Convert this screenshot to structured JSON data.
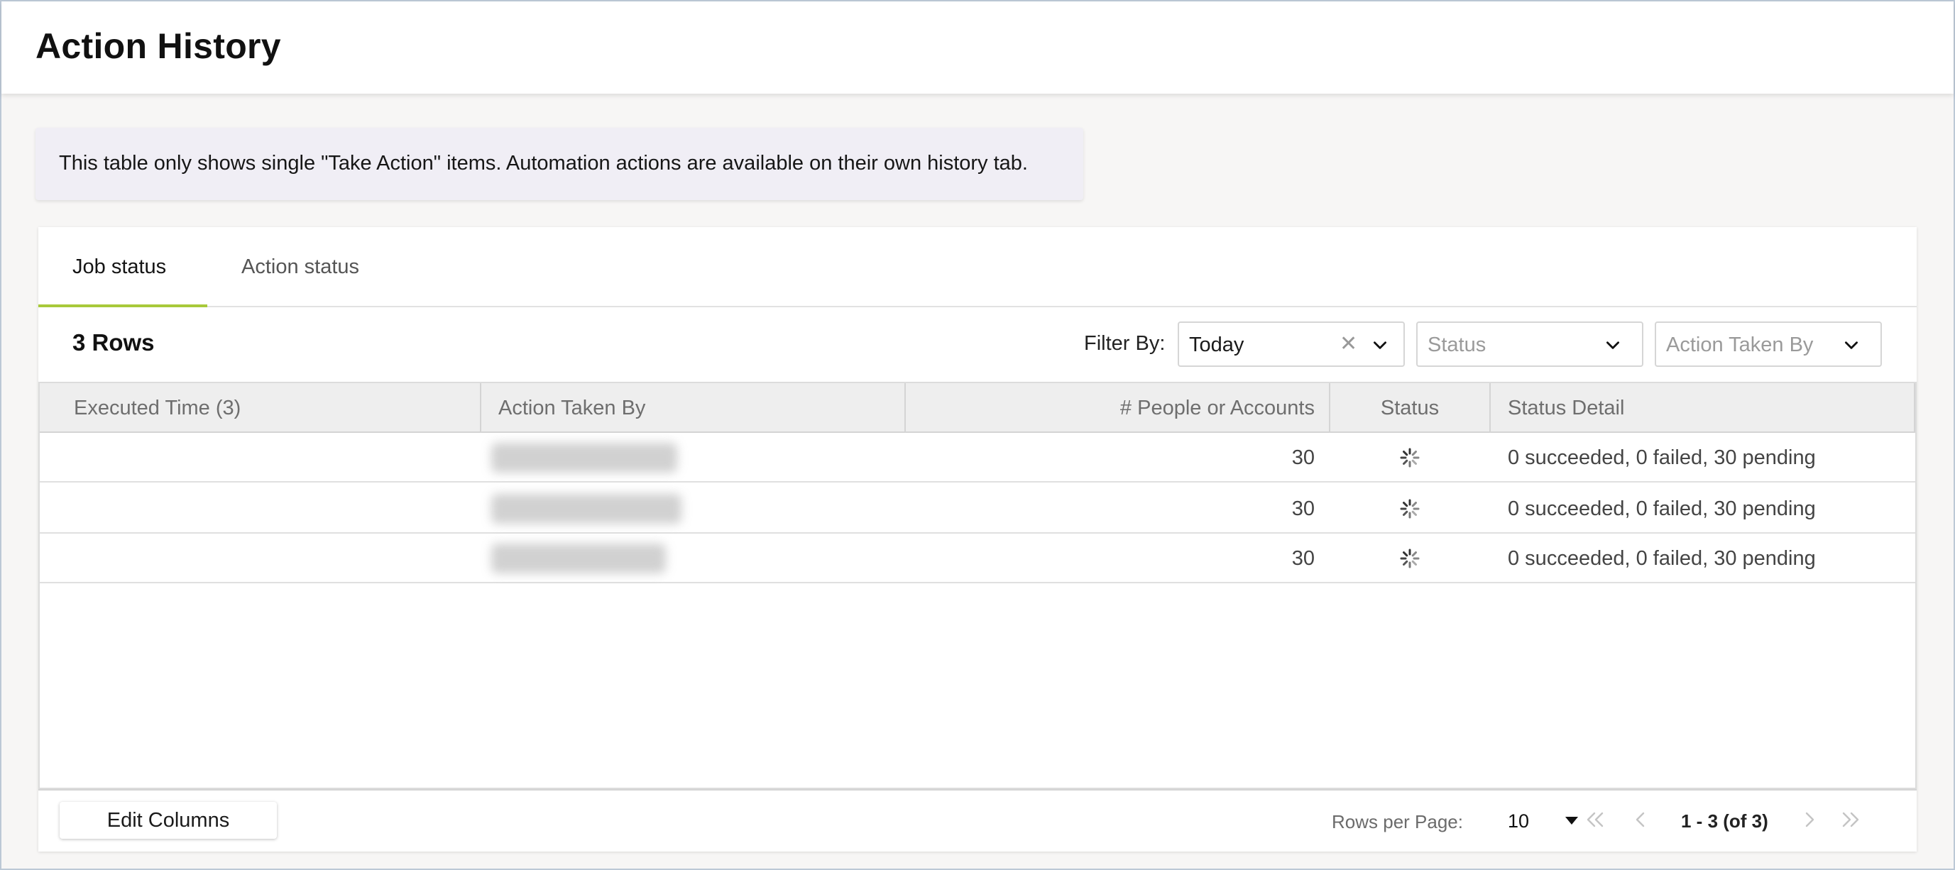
{
  "page": {
    "title": "Action History"
  },
  "notice": {
    "text": "This table only shows single \"Take Action\" items. Automation actions are available on their own history tab."
  },
  "tabs": [
    {
      "label": "Job status",
      "active": true
    },
    {
      "label": "Action status",
      "active": false
    }
  ],
  "toolbar": {
    "row_count": "3 Rows",
    "filter_label": "Filter By:",
    "filters": [
      {
        "value": "Today",
        "placeholder": "",
        "clearable": true
      },
      {
        "value": "",
        "placeholder": "Status",
        "clearable": false
      },
      {
        "value": "",
        "placeholder": "Action Taken By",
        "clearable": false
      }
    ]
  },
  "table": {
    "columns": [
      "Executed Time (3)",
      "Action Taken By",
      "# People or Accounts",
      "Status",
      "Status Detail"
    ],
    "rows": [
      {
        "executed_time": "",
        "action_taken_by": "[redacted]",
        "people_or_accounts": "30",
        "status": "pending-spinner-icon",
        "status_detail": "0 succeeded, 0 failed, 30 pending"
      },
      {
        "executed_time": "",
        "action_taken_by": "[redacted]",
        "people_or_accounts": "30",
        "status": "pending-spinner-icon",
        "status_detail": "0 succeeded, 0 failed, 30 pending"
      },
      {
        "executed_time": "",
        "action_taken_by": "[redacted]",
        "people_or_accounts": "30",
        "status": "pending-spinner-icon",
        "status_detail": "0 succeeded, 0 failed, 30 pending"
      }
    ]
  },
  "footer": {
    "edit_columns_label": "Edit Columns",
    "rows_per_page_label": "Rows per Page:",
    "rows_per_page_value": "10",
    "range_text": "1 - 3 (of 3)"
  },
  "colors": {
    "active_tab_underline": "#a8c93a",
    "notice_background": "#f0eef5",
    "page_background": "#f7f6f5"
  }
}
